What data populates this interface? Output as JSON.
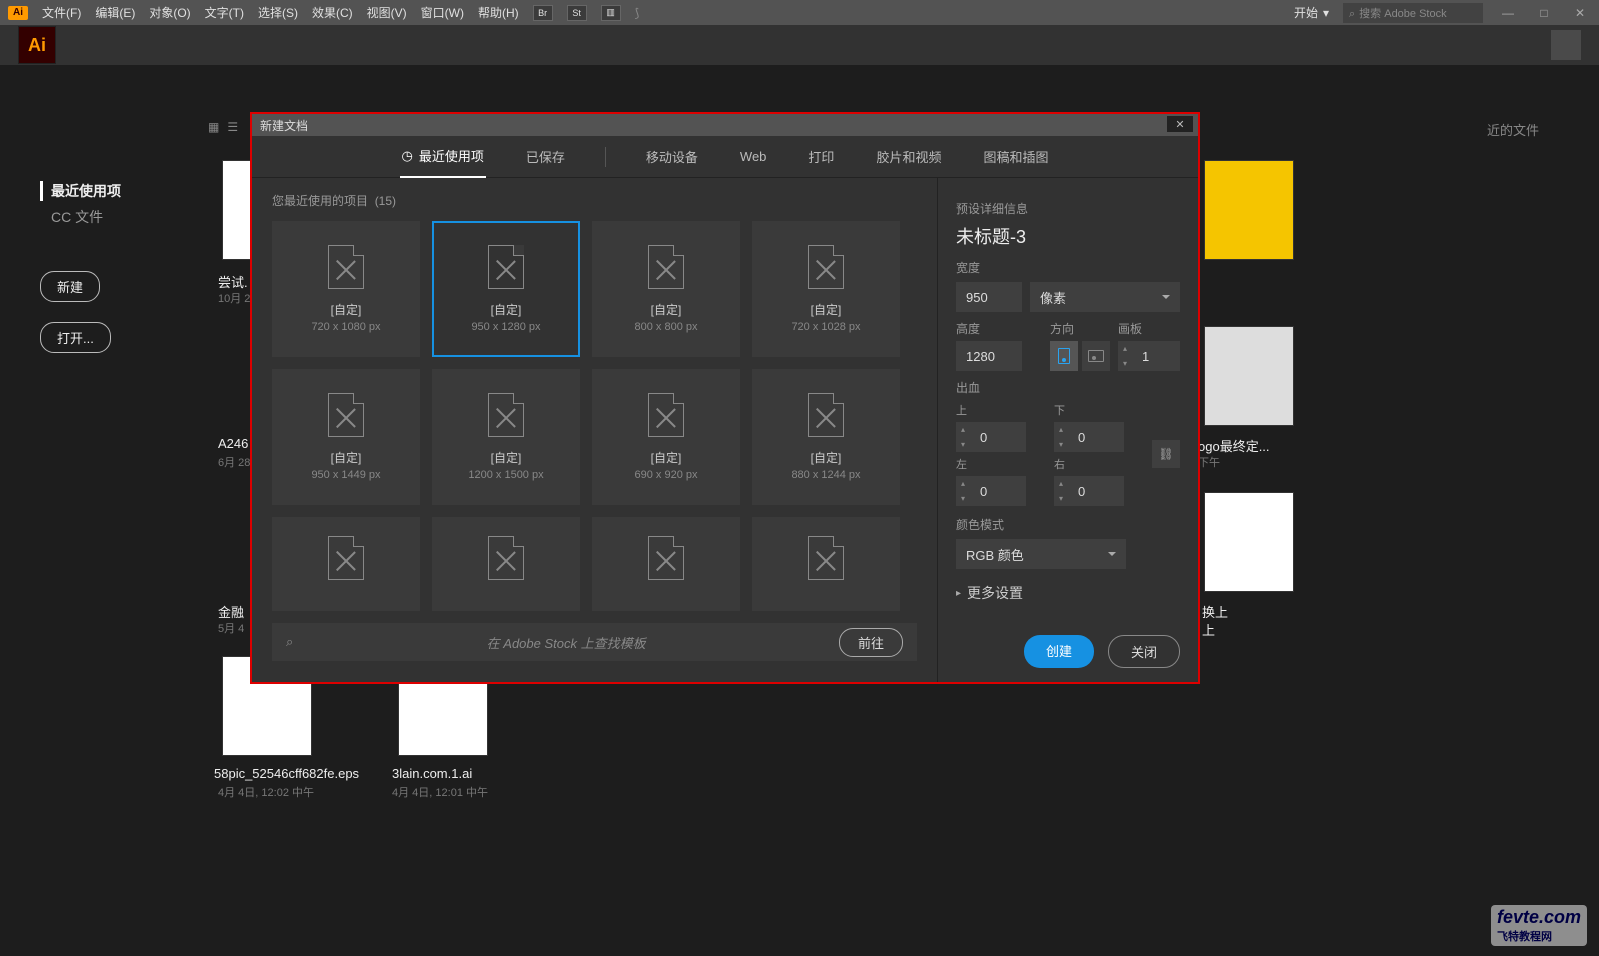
{
  "menubar": {
    "logo": "Ai",
    "items": [
      "文件(F)",
      "编辑(E)",
      "对象(O)",
      "文字(T)",
      "选择(S)",
      "效果(C)",
      "视图(V)",
      "窗口(W)",
      "帮助(H)"
    ],
    "br": "Br",
    "st": "St",
    "start": "开始",
    "search_ph": "搜索 Adobe Stock"
  },
  "appbar": {
    "logo": "Ai"
  },
  "sortby": "近的文件",
  "left": {
    "recent": "最近使用项",
    "cc": "CC 文件",
    "new": "新建",
    "open": "打开..."
  },
  "bg_items": [
    {
      "name": "尝试.",
      "date": "10月 2"
    },
    {
      "name": "A246",
      "date": "6月 28"
    },
    {
      "name": "金融",
      "date": "5月 4"
    },
    {
      "name": "58pic_52546cff682fe.eps",
      "date": "4月 4日, 12:02 中午"
    },
    {
      "name": "3lain.com.1.ai",
      "date": "4月 4日, 12:01 中午"
    },
    {
      "name": "ogo最终定...",
      "date": "下午"
    },
    {
      "name": "换上",
      "date": ""
    },
    {
      "name": "上",
      "date": ""
    }
  ],
  "dialog": {
    "title": "新建文档",
    "tabs": [
      "最近使用项",
      "已保存",
      "移动设备",
      "Web",
      "打印",
      "胶片和视频",
      "图稿和插图"
    ],
    "recent_label": "您最近使用的项目",
    "recent_count": "(15)",
    "cards": [
      {
        "name": "[自定]",
        "size": "720 x 1080 px"
      },
      {
        "name": "[自定]",
        "size": "950 x 1280 px"
      },
      {
        "name": "[自定]",
        "size": "800 x 800 px"
      },
      {
        "name": "[自定]",
        "size": "720 x 1028 px"
      },
      {
        "name": "[自定]",
        "size": "950 x 1449 px"
      },
      {
        "name": "[自定]",
        "size": "1200 x 1500 px"
      },
      {
        "name": "[自定]",
        "size": "690 x 920 px"
      },
      {
        "name": "[自定]",
        "size": "880 x 1244 px"
      },
      {
        "name": "",
        "size": ""
      },
      {
        "name": "",
        "size": ""
      },
      {
        "name": "",
        "size": ""
      },
      {
        "name": "",
        "size": ""
      }
    ],
    "search_ph": "在 Adobe Stock 上查找模板",
    "go": "前往",
    "right": {
      "preset_label": "预设详细信息",
      "title": "未标题-3",
      "width_label": "宽度",
      "width": "950",
      "unit": "像素",
      "height_label": "高度",
      "height": "1280",
      "orient_label": "方向",
      "artboard_label": "画板",
      "artboards": "1",
      "bleed_label": "出血",
      "top": "上",
      "bottom": "下",
      "left": "左",
      "right": "右",
      "bleed_t": "0",
      "bleed_b": "0",
      "bleed_l": "0",
      "bleed_r": "0",
      "color_label": "颜色模式",
      "color": "RGB 颜色",
      "more": "更多设置"
    },
    "create": "创建",
    "close": "关闭"
  },
  "watermark": {
    "main": "fevte.com",
    "sub": "飞特教程网"
  }
}
